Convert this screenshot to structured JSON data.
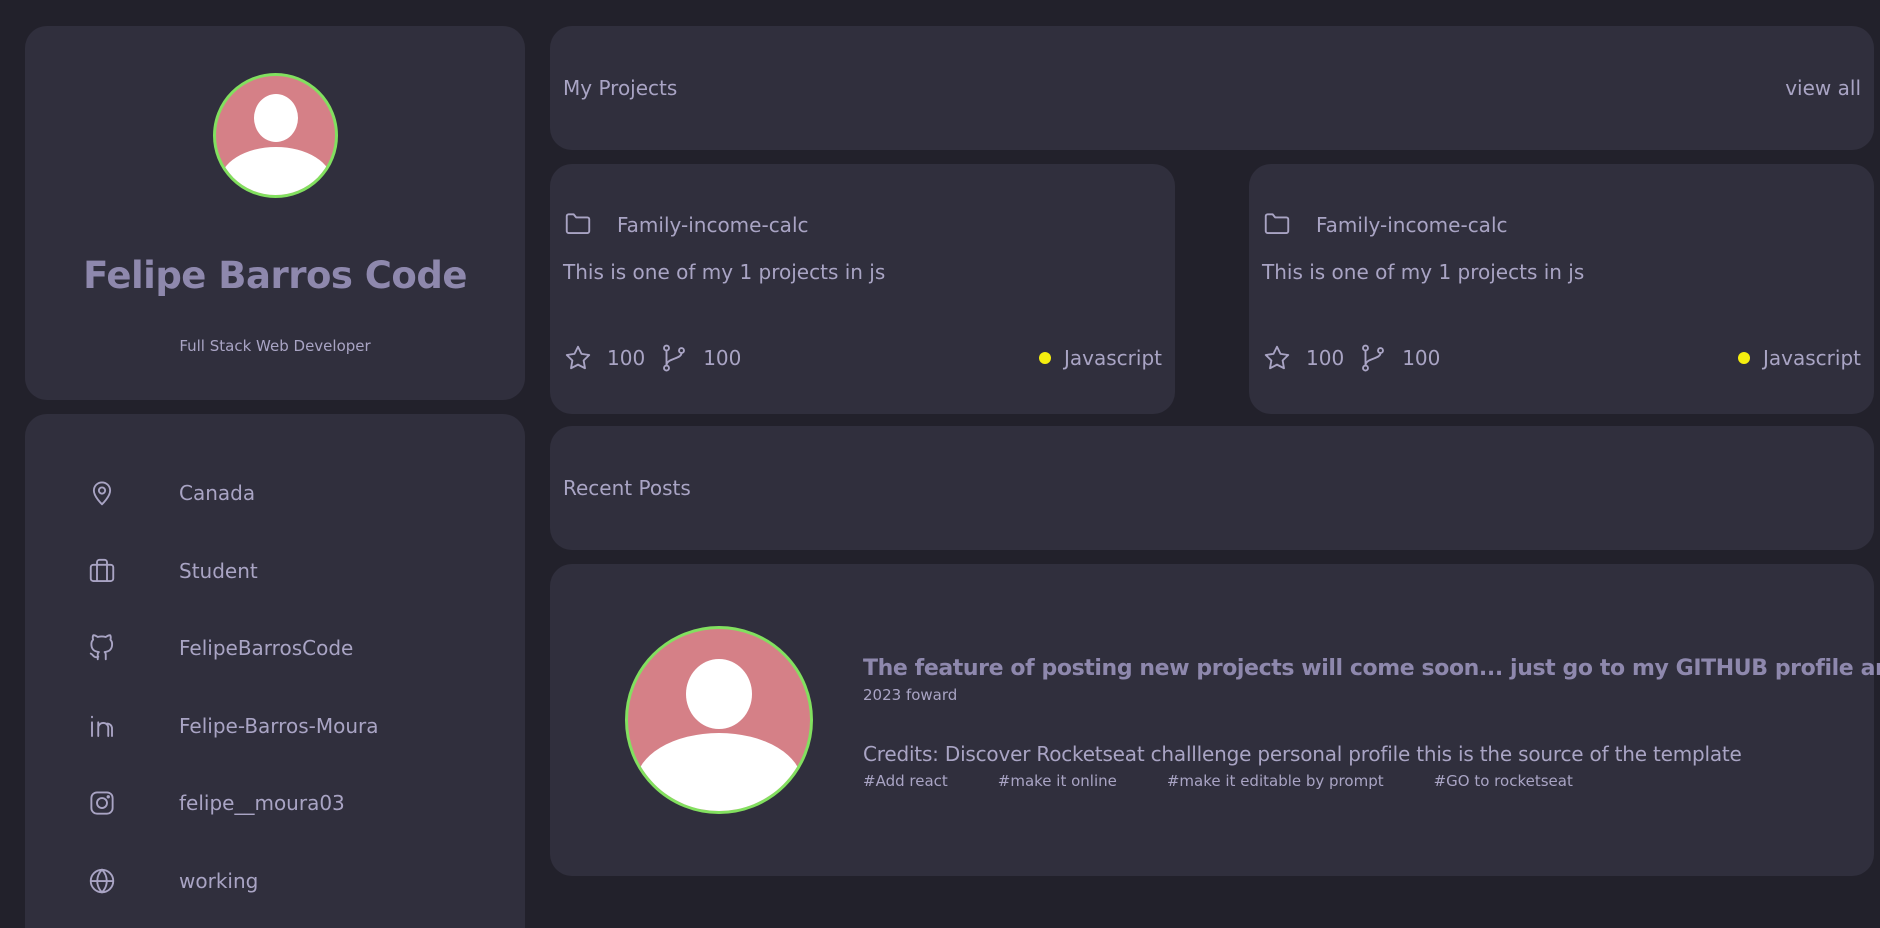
{
  "profile": {
    "name": "Felipe Barros Code",
    "role": "Full Stack Web Developer"
  },
  "info": {
    "location": "Canada",
    "occupation": "Student",
    "github": "FelipeBarrosCode",
    "linkedin": "Felipe-Barros-Moura",
    "instagram": "felipe__moura03",
    "website": "working"
  },
  "projects": {
    "title": "My Projects",
    "view_all": "view all",
    "items": [
      {
        "name": "Family-income-calc",
        "description": "This is one of my 1 projects in js",
        "stars": "100",
        "forks": "100",
        "language": "Javascript"
      },
      {
        "name": "Family-income-calc",
        "description": "This is one of my 1 projects in js",
        "stars": "100",
        "forks": "100",
        "language": "Javascript"
      }
    ]
  },
  "posts": {
    "title": "Recent Posts",
    "item": {
      "title": "The feature of posting new projects will come soon... just go to my GITHUB profile and see",
      "date": "2023 foward",
      "credits": "Credits: Discover Rocketseat challlenge personal profile this is the source of the template",
      "tags": [
        "#Add react",
        "#make it online",
        "#make it editable by prompt",
        "#GO to rocketseat"
      ]
    }
  },
  "colors": {
    "background": "#22212b",
    "card": "#302f3d",
    "text": "#a9a4c4",
    "heading": "#8e88ad",
    "avatar_bg": "#d58087",
    "avatar_ring": "#82e05f",
    "language_dot": "#f5ee0f"
  },
  "icons": [
    "location-icon",
    "briefcase-icon",
    "github-icon",
    "linkedin-icon",
    "instagram-icon",
    "globe-icon",
    "folder-icon",
    "star-icon",
    "git-fork-icon"
  ]
}
